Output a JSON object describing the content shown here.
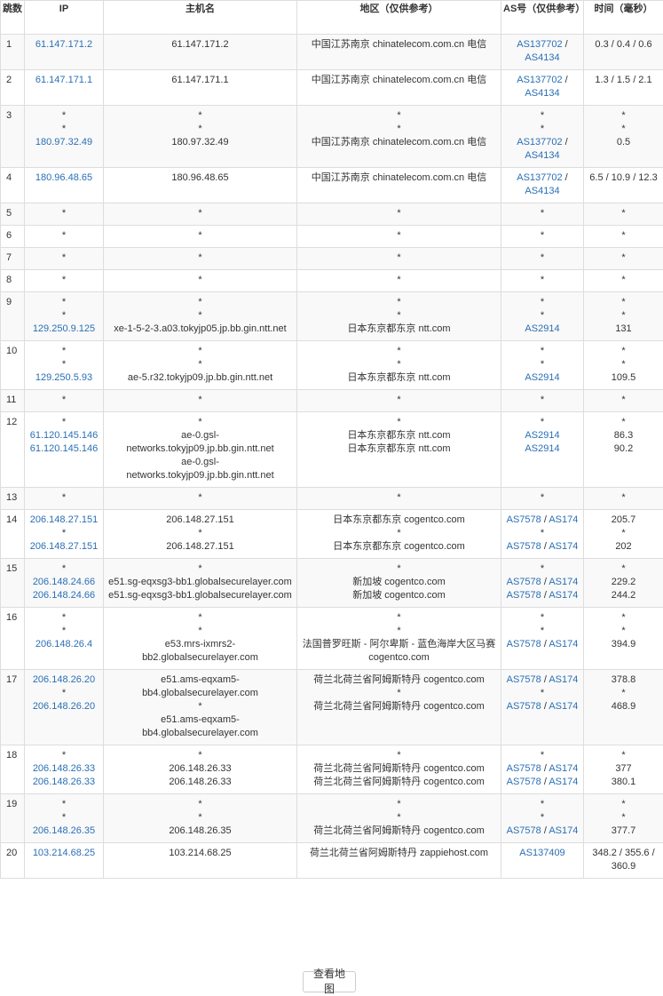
{
  "headers": {
    "hop": "跳数",
    "ip": "IP",
    "host": "主机名",
    "region": "地区（仅供参考）",
    "as": "AS号（仅供参考）",
    "time": "时间（毫秒）"
  },
  "map_button": "查看地图",
  "colors": {
    "link": "#2a6fb5",
    "border": "#dddddd",
    "stripe": "#f9f9f9"
  },
  "rows": [
    {
      "hop": "1",
      "ip": [
        "61.147.171.2"
      ],
      "host": [
        "61.147.171.2"
      ],
      "region": [
        "中国江苏南京 chinatelecom.com.cn 电信"
      ],
      "as": [
        [
          "AS137702",
          "AS4134"
        ]
      ],
      "time": [
        "0.3 / 0.4 / 0.6"
      ]
    },
    {
      "hop": "2",
      "ip": [
        "61.147.171.1"
      ],
      "host": [
        "61.147.171.1"
      ],
      "region": [
        "中国江苏南京 chinatelecom.com.cn 电信"
      ],
      "as": [
        [
          "AS137702",
          "AS4134"
        ]
      ],
      "time": [
        "1.3 / 1.5 / 2.1"
      ]
    },
    {
      "hop": "3",
      "ip": [
        "*",
        "*",
        "180.97.32.49"
      ],
      "host": [
        "*",
        "*",
        "180.97.32.49"
      ],
      "region": [
        "*",
        "*",
        "中国江苏南京 chinatelecom.com.cn 电信"
      ],
      "as": [
        "*",
        "*",
        [
          "AS137702",
          "AS4134"
        ]
      ],
      "time": [
        "*",
        "*",
        "0.5"
      ]
    },
    {
      "hop": "4",
      "ip": [
        "180.96.48.65"
      ],
      "host": [
        "180.96.48.65"
      ],
      "region": [
        "中国江苏南京 chinatelecom.com.cn 电信"
      ],
      "as": [
        [
          "AS137702",
          "AS4134"
        ]
      ],
      "time": [
        "6.5 / 10.9 / 12.3"
      ]
    },
    {
      "hop": "5",
      "ip": [
        "*"
      ],
      "host": [
        "*"
      ],
      "region": [
        "*"
      ],
      "as": [
        "*"
      ],
      "time": [
        "*"
      ]
    },
    {
      "hop": "6",
      "ip": [
        "*"
      ],
      "host": [
        "*"
      ],
      "region": [
        "*"
      ],
      "as": [
        "*"
      ],
      "time": [
        "*"
      ]
    },
    {
      "hop": "7",
      "ip": [
        "*"
      ],
      "host": [
        "*"
      ],
      "region": [
        "*"
      ],
      "as": [
        "*"
      ],
      "time": [
        "*"
      ]
    },
    {
      "hop": "8",
      "ip": [
        "*"
      ],
      "host": [
        "*"
      ],
      "region": [
        "*"
      ],
      "as": [
        "*"
      ],
      "time": [
        "*"
      ]
    },
    {
      "hop": "9",
      "ip": [
        "*",
        "*",
        "129.250.9.125"
      ],
      "host": [
        "*",
        "*",
        "xe-1-5-2-3.a03.tokyjp05.jp.bb.gin.ntt.net"
      ],
      "region": [
        "*",
        "*",
        "日本东京都东京 ntt.com"
      ],
      "as": [
        "*",
        "*",
        [
          "AS2914"
        ]
      ],
      "time": [
        "*",
        "*",
        "131"
      ]
    },
    {
      "hop": "10",
      "ip": [
        "*",
        "*",
        "129.250.5.93"
      ],
      "host": [
        "*",
        "*",
        "ae-5.r32.tokyjp09.jp.bb.gin.ntt.net"
      ],
      "region": [
        "*",
        "*",
        "日本东京都东京 ntt.com"
      ],
      "as": [
        "*",
        "*",
        [
          "AS2914"
        ]
      ],
      "time": [
        "*",
        "*",
        "109.5"
      ]
    },
    {
      "hop": "11",
      "ip": [
        "*"
      ],
      "host": [
        "*"
      ],
      "region": [
        "*"
      ],
      "as": [
        "*"
      ],
      "time": [
        "*"
      ]
    },
    {
      "hop": "12",
      "ip": [
        "*",
        "61.120.145.146",
        "61.120.145.146"
      ],
      "host": [
        "*",
        "ae-0.gsl-networks.tokyjp09.jp.bb.gin.ntt.net",
        "ae-0.gsl-networks.tokyjp09.jp.bb.gin.ntt.net"
      ],
      "region": [
        "*",
        "日本东京都东京 ntt.com",
        "日本东京都东京 ntt.com"
      ],
      "as": [
        "*",
        [
          "AS2914"
        ],
        [
          "AS2914"
        ]
      ],
      "time": [
        "*",
        "86.3",
        "90.2"
      ]
    },
    {
      "hop": "13",
      "ip": [
        "*"
      ],
      "host": [
        "*"
      ],
      "region": [
        "*"
      ],
      "as": [
        "*"
      ],
      "time": [
        "*"
      ]
    },
    {
      "hop": "14",
      "ip": [
        "206.148.27.151",
        "*",
        "206.148.27.151"
      ],
      "host": [
        "206.148.27.151",
        "*",
        "206.148.27.151"
      ],
      "region": [
        "日本东京都东京 cogentco.com",
        "*",
        "日本东京都东京 cogentco.com"
      ],
      "as": [
        [
          "AS7578",
          "AS174"
        ],
        "*",
        [
          "AS7578",
          "AS174"
        ]
      ],
      "time": [
        "205.7",
        "*",
        "202"
      ]
    },
    {
      "hop": "15",
      "ip": [
        "*",
        "206.148.24.66",
        "206.148.24.66"
      ],
      "host": [
        "*",
        "e51.sg-eqxsg3-bb1.globalsecurelayer.com",
        "e51.sg-eqxsg3-bb1.globalsecurelayer.com"
      ],
      "region": [
        "*",
        "新加坡 cogentco.com",
        "新加坡 cogentco.com"
      ],
      "as": [
        "*",
        [
          "AS7578",
          "AS174"
        ],
        [
          "AS7578",
          "AS174"
        ]
      ],
      "time": [
        "*",
        "229.2",
        "244.2"
      ]
    },
    {
      "hop": "16",
      "ip": [
        "*",
        "*",
        "206.148.26.4"
      ],
      "host": [
        "*",
        "*",
        "e53.mrs-ixmrs2-bb2.globalsecurelayer.com"
      ],
      "region": [
        "*",
        "*",
        "法国普罗旺斯 - 阿尔卑斯 - 蓝色海岸大区马赛 cogentco.com"
      ],
      "as": [
        "*",
        "*",
        [
          "AS7578",
          "AS174"
        ]
      ],
      "time": [
        "*",
        "*",
        "394.9"
      ]
    },
    {
      "hop": "17",
      "ip": [
        "206.148.26.20",
        "*",
        "206.148.26.20"
      ],
      "host": [
        "e51.ams-eqxam5-bb4.globalsecurelayer.com",
        "*",
        "e51.ams-eqxam5-bb4.globalsecurelayer.com"
      ],
      "region": [
        "荷兰北荷兰省阿姆斯特丹 cogentco.com",
        "*",
        "荷兰北荷兰省阿姆斯特丹 cogentco.com"
      ],
      "as": [
        [
          "AS7578",
          "AS174"
        ],
        "*",
        [
          "AS7578",
          "AS174"
        ]
      ],
      "time": [
        "378.8",
        "*",
        "468.9"
      ]
    },
    {
      "hop": "18",
      "ip": [
        "*",
        "206.148.26.33",
        "206.148.26.33"
      ],
      "host": [
        "*",
        "206.148.26.33",
        "206.148.26.33"
      ],
      "region": [
        "*",
        "荷兰北荷兰省阿姆斯特丹 cogentco.com",
        "荷兰北荷兰省阿姆斯特丹 cogentco.com"
      ],
      "as": [
        "*",
        [
          "AS7578",
          "AS174"
        ],
        [
          "AS7578",
          "AS174"
        ]
      ],
      "time": [
        "*",
        "377",
        "380.1"
      ]
    },
    {
      "hop": "19",
      "ip": [
        "*",
        "*",
        "206.148.26.35"
      ],
      "host": [
        "*",
        "*",
        "206.148.26.35"
      ],
      "region": [
        "*",
        "*",
        "荷兰北荷兰省阿姆斯特丹 cogentco.com"
      ],
      "as": [
        "*",
        "*",
        [
          "AS7578",
          "AS174"
        ]
      ],
      "time": [
        "*",
        "*",
        "377.7"
      ]
    },
    {
      "hop": "20",
      "ip": [
        "103.214.68.25"
      ],
      "host": [
        "103.214.68.25"
      ],
      "region": [
        "荷兰北荷兰省阿姆斯特丹 zappiehost.com"
      ],
      "as": [
        [
          "AS137409"
        ]
      ],
      "time": [
        "348.2 / 355.6 / 360.9"
      ]
    }
  ]
}
